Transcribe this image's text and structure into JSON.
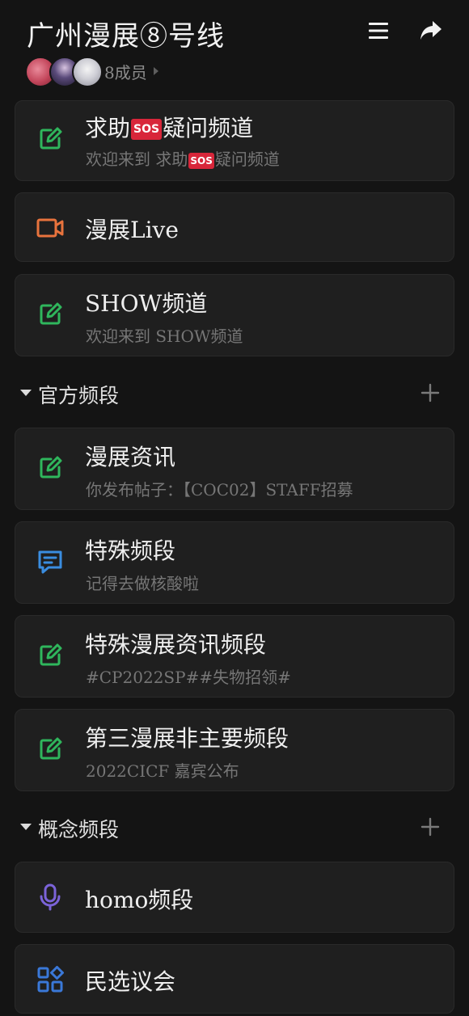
{
  "header": {
    "title": "广州漫展⑧号线",
    "member_count": "8成员"
  },
  "channels_top": [
    {
      "name_pre": "求助",
      "name_badge": "SOS",
      "name_post": "疑问频道",
      "sub_pre": "欢迎来到 求助",
      "sub_badge": "SOS",
      "sub_post": "疑问频道",
      "icon": "edit-icon"
    },
    {
      "name": "漫展Live",
      "icon": "video-camera-icon"
    },
    {
      "name": "SHOW频道",
      "sub": "欢迎来到 SHOW频道",
      "icon": "edit-icon"
    }
  ],
  "sections": [
    {
      "label": "官方频段",
      "channels": [
        {
          "name": "漫展资讯",
          "sub": "你发布帖子：【COC02】STAFF招募",
          "icon": "edit-icon"
        },
        {
          "name": "特殊频段",
          "sub": "记得去做核酸啦",
          "icon": "chat-icon"
        },
        {
          "name": "特殊漫展资讯频段",
          "sub": "#CP2022SP##失物招领#",
          "icon": "edit-icon"
        },
        {
          "name": "第三漫展非主要频段",
          "sub": "2022CICF 嘉宾公布",
          "icon": "edit-icon"
        }
      ]
    },
    {
      "label": "概念频段",
      "channels": [
        {
          "name": "homo频段",
          "icon": "microphone-icon"
        },
        {
          "name": "民选议会",
          "icon": "apps-grid-icon"
        }
      ]
    }
  ],
  "colors": {
    "background": "#141414",
    "card": "#1f1f1f",
    "edit_icon": "#2fb65c",
    "video_icon": "#e8733d",
    "chat_icon": "#3a8de0",
    "mic_icon": "#7b63d8",
    "grid_icon": "#3a78d8",
    "sos_badge": "#d8263a"
  }
}
